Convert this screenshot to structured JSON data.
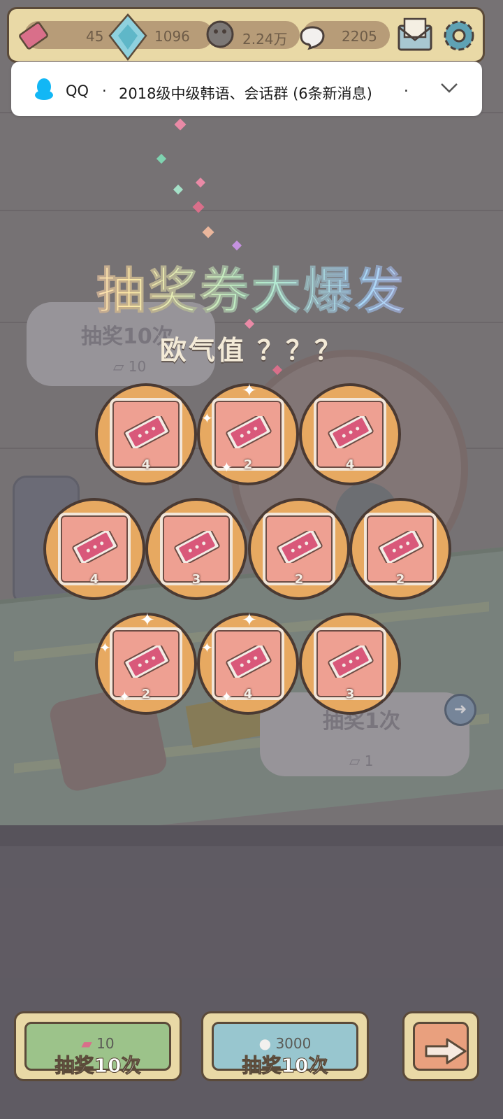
{
  "hud": {
    "tickets": "45",
    "gems": "1096",
    "coins": "2.24万",
    "souls": "2205"
  },
  "notification": {
    "app": "QQ",
    "separator": "·",
    "message": "2018级中级韩语、会话群 (6条新消息)",
    "trailing": "·"
  },
  "event": {
    "title": "抽奖券大爆发",
    "luck_label": "欧气值 ？？？"
  },
  "background": {
    "panel_left_title": "抽奖10次",
    "panel_left_cost": "10",
    "panel_right_title": "抽奖1次",
    "panel_right_cost": "1"
  },
  "rewards": [
    {
      "count": "4"
    },
    {
      "count": "2"
    },
    {
      "count": "4"
    },
    {
      "count": "4"
    },
    {
      "count": "3"
    },
    {
      "count": "2"
    },
    {
      "count": "2"
    },
    {
      "count": "2"
    },
    {
      "count": "4"
    },
    {
      "count": "3"
    }
  ],
  "buttons": {
    "ticket_draw": {
      "cost": "10",
      "label": "抽奖10次"
    },
    "soul_draw": {
      "cost": "3000",
      "label": "抽奖10次"
    }
  },
  "colors": {
    "coin": "#e7a961",
    "card": "#eea092",
    "hud_bg": "#e9d9a6",
    "green_button": "#9cc38a",
    "blue_button": "#98c6cf",
    "arrow_button": "#e9a07e"
  }
}
